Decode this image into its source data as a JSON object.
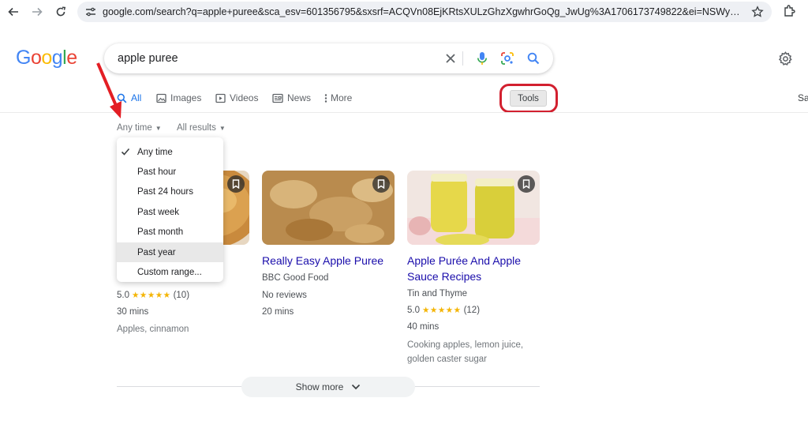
{
  "browser": {
    "url": "google.com/search?q=apple+puree&sca_esv=601356795&sxsrf=ACQVn08EjKRtsXULzGhzXgwhrGoQg_JwUg%3A1706173749822&ei=NSWyZbfbMaKMIQf6vqL..."
  },
  "search": {
    "logo_letters": [
      {
        "char": "G",
        "color": "#4285F4"
      },
      {
        "char": "o",
        "color": "#EA4335"
      },
      {
        "char": "o",
        "color": "#FBBC05"
      },
      {
        "char": "g",
        "color": "#4285F4"
      },
      {
        "char": "l",
        "color": "#34A853"
      },
      {
        "char": "e",
        "color": "#EA4335"
      }
    ],
    "query": "apple puree"
  },
  "tabs": [
    {
      "label": "All",
      "icon": "search-icon",
      "active": true
    },
    {
      "label": "Images",
      "icon": "image-icon",
      "active": false
    },
    {
      "label": "Videos",
      "icon": "play-icon",
      "active": false
    },
    {
      "label": "News",
      "icon": "news-icon",
      "active": false
    },
    {
      "label": "More",
      "icon": "more-vertical-icon",
      "active": false
    }
  ],
  "tools_label": "Tools",
  "cut_tab_label": "Sa",
  "filters": {
    "time": "Any time",
    "results": "All results"
  },
  "time_menu": {
    "items": [
      {
        "label": "Any time",
        "checked": true,
        "hovered": false
      },
      {
        "label": "Past hour",
        "checked": false,
        "hovered": false
      },
      {
        "label": "Past 24 hours",
        "checked": false,
        "hovered": false
      },
      {
        "label": "Past week",
        "checked": false,
        "hovered": false
      },
      {
        "label": "Past month",
        "checked": false,
        "hovered": false
      },
      {
        "label": "Past year",
        "checked": false,
        "hovered": true
      },
      {
        "label": "Custom range...",
        "checked": false,
        "hovered": false
      }
    ]
  },
  "recipes": [
    {
      "title": "",
      "source": "",
      "rating": "5.0",
      "stars": "★★★★★",
      "reviews": "(10)",
      "time": "30 mins",
      "ingredients": "Apples, cinnamon"
    },
    {
      "title": "Really Easy Apple Puree",
      "source": "BBC Good Food",
      "rating_text": "No reviews",
      "time": "20 mins"
    },
    {
      "title": "Apple Purée And Apple Sauce Recipes",
      "source": "Tin and Thyme",
      "rating": "5.0",
      "stars": "★★★★★",
      "reviews": "(12)",
      "time": "40 mins",
      "ingredients": "Cooking apples, lemon juice, golden caster sugar"
    }
  ],
  "show_more_label": "Show more",
  "colors": {
    "link": "#1a0dab",
    "active_tab": "#1a73e8",
    "annotation_red": "#d2202f",
    "star": "#f4b400"
  }
}
